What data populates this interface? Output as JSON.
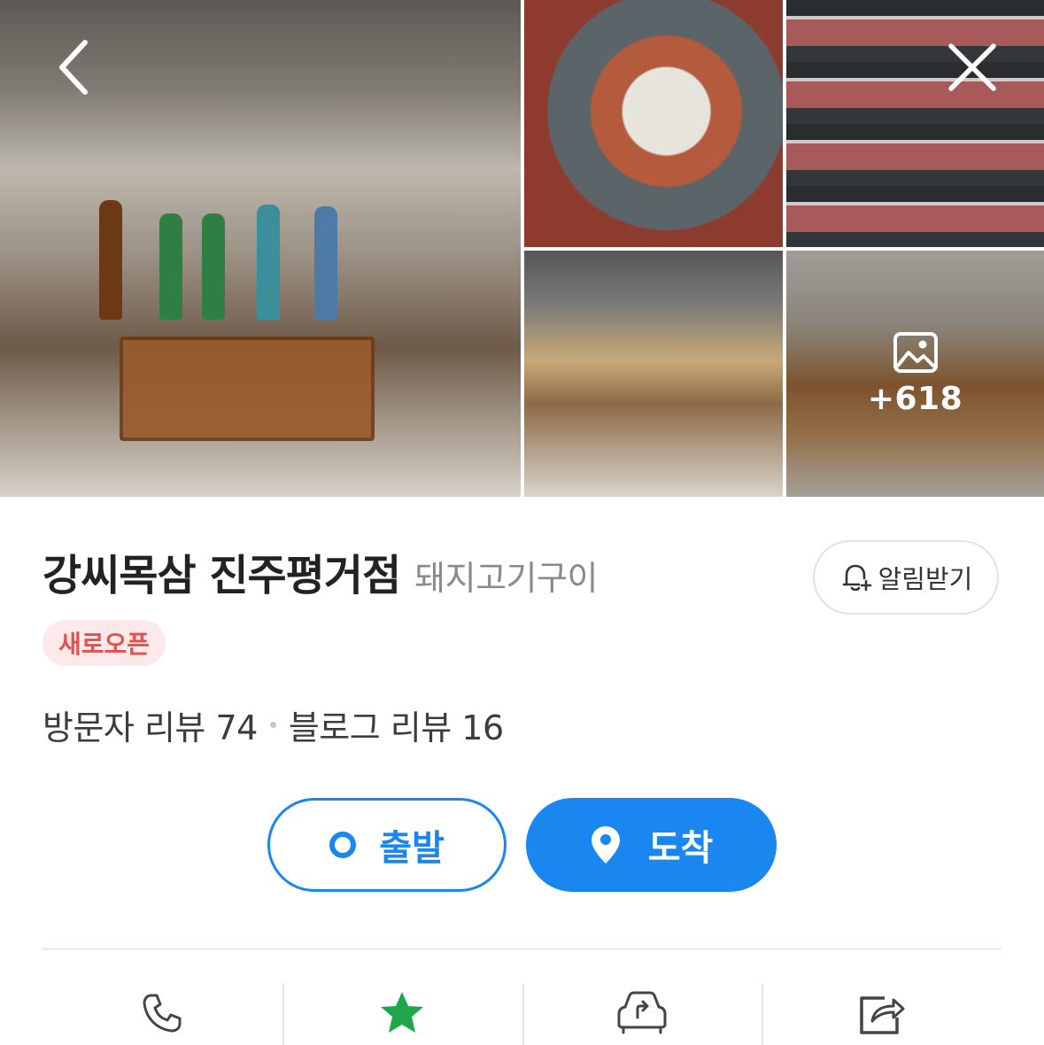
{
  "photos": {
    "items": [
      {
        "name": "main-photo",
        "alt": ""
      },
      {
        "name": "food-photo",
        "alt": ""
      },
      {
        "name": "meat-fridge-photo",
        "alt": ""
      },
      {
        "name": "hall-photo",
        "alt": ""
      },
      {
        "name": "booth-photo",
        "alt": ""
      }
    ],
    "more_count": "+618",
    "back_icon": "chevron-left-icon",
    "close_icon": "close-icon"
  },
  "place": {
    "name": "강씨목삼 진주평거점",
    "category": "돼지고기구이",
    "badge": "새로오픈",
    "alarm_label": "알림받기",
    "visitor_review": "방문자 리뷰 74",
    "blog_review": "블로그 리뷰 16"
  },
  "route": {
    "start_label": "출발",
    "arrive_label": "도착"
  },
  "actions": [
    {
      "name": "call",
      "icon": "phone-icon"
    },
    {
      "name": "save",
      "icon": "star-icon"
    },
    {
      "name": "taxi",
      "icon": "car-route-icon"
    },
    {
      "name": "share",
      "icon": "share-icon"
    }
  ],
  "colors": {
    "accent": "#1a86f0",
    "badge_bg": "#fde9ea",
    "badge_text": "#e5504b",
    "star": "#1fa64a"
  }
}
